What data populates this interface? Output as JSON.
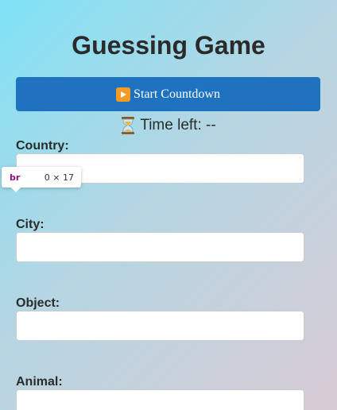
{
  "page": {
    "title": "Guessing Game"
  },
  "countdown": {
    "button_label": "Start Countdown",
    "button_icon": "play-button-icon",
    "timer_icon": "hourglass-icon",
    "timer_text": "Time left: --"
  },
  "fields": [
    {
      "label": "Country:",
      "value": ""
    },
    {
      "label": "City:",
      "value": ""
    },
    {
      "label": "Object:",
      "value": ""
    },
    {
      "label": "Animal:",
      "value": ""
    }
  ],
  "devtools_tooltip": {
    "tag": "br",
    "dimensions": "0 × 17"
  },
  "colors": {
    "accent": "#1f72c0",
    "background_start": "#7fe2f6",
    "background_end": "#d8cbd4",
    "tooltip_tag": "#881280"
  }
}
